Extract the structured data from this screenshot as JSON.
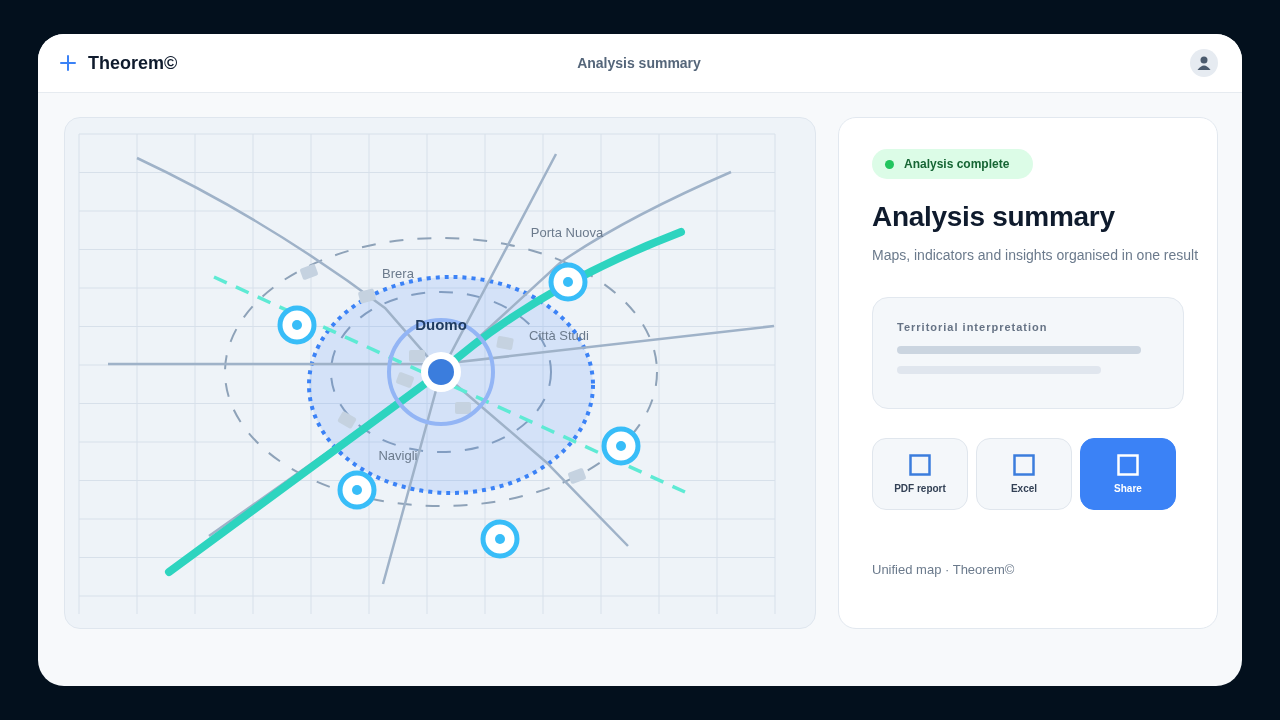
{
  "app": {
    "title": "Theorem©",
    "page_title": "Analysis summary"
  },
  "map": {
    "labels": [
      {
        "text": "Porta Nuova",
        "kind": "district"
      },
      {
        "text": "Brera",
        "kind": "district"
      },
      {
        "text": "Duomo",
        "kind": "center"
      },
      {
        "text": "Città Studi",
        "kind": "district"
      },
      {
        "text": "Navigli",
        "kind": "district"
      }
    ]
  },
  "summary": {
    "status": "Analysis complete",
    "title": "Analysis summary",
    "subtitle": "Maps, indicators and insights organised in one result",
    "interpretation": {
      "title": "Territorial interpretation"
    },
    "actions": [
      {
        "label": "PDF report",
        "kind": "secondary"
      },
      {
        "label": "Excel",
        "kind": "secondary"
      },
      {
        "label": "Share",
        "kind": "primary"
      }
    ],
    "footer": "Unified map · Theorem©"
  }
}
